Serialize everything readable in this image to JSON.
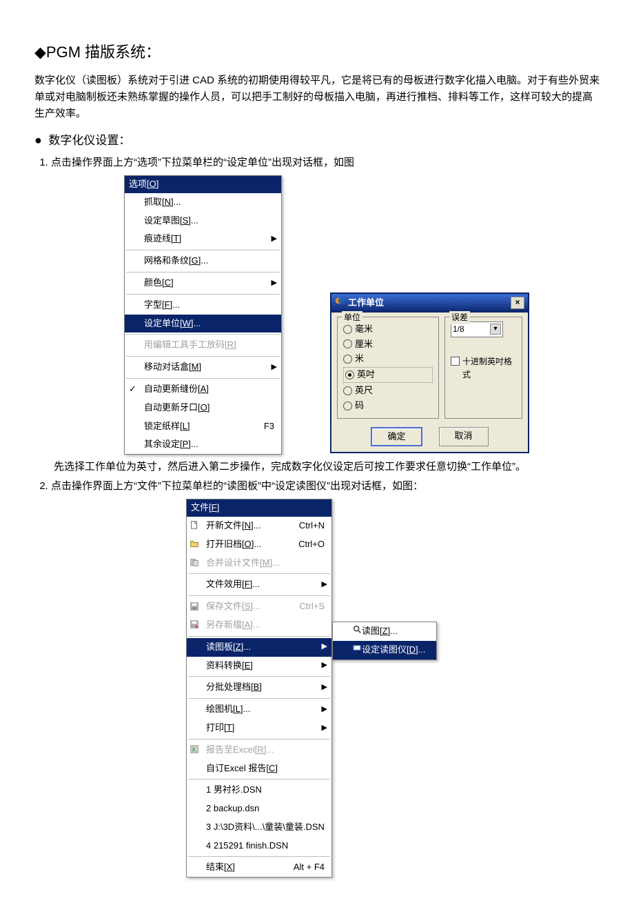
{
  "heading": "PGM 描版系统：",
  "intro": "数字化仪（读图板）系统对于引进 CAD 系统的初期使用得较平凡，它是将已有的母板进行数字化描入电脑。对于有些外贸来单或对电脑制板还未熟练掌握的操作人员，可以把手工制好的母板描入电脑，再进行推档、排料等工作，这样可较大的提高生产效率。",
  "h2": "数字化仪设置：",
  "step1": "点击操作界面上方“选项”下拉菜单栏的“设定单位”出现对话框，如图",
  "step1_note": "先选择工作单位为英寸，然后进入第二步操作，完成数字化仪设定后可按工作要求任意切换“工作单位”。",
  "step2": "点击操作界面上方“文件”下拉菜单栏的“读图板”中“设定读图仪”出现对话框，如图：",
  "menu1": {
    "title": "选项[O]",
    "items": [
      {
        "label": "抓取[N]..."
      },
      {
        "label": "设定草图[S]..."
      },
      {
        "label": "痕迹线[T]",
        "arrow": true
      },
      {
        "sep": true
      },
      {
        "label": "网格和条纹[G]..."
      },
      {
        "sep": true
      },
      {
        "label": "颜色[C]",
        "arrow": true
      },
      {
        "sep": true
      },
      {
        "label": "字型[F]..."
      },
      {
        "label": "设定单位[W]...",
        "sel": true
      },
      {
        "sep": true
      },
      {
        "label": "用编辑工具手工放码[R]",
        "disabled": true
      },
      {
        "sep": true
      },
      {
        "label": "移动对话盒[M]",
        "arrow": true
      },
      {
        "sep": true
      },
      {
        "label": "自动更新缝份[A]",
        "check": true
      },
      {
        "label": "自动更新牙口[O]"
      },
      {
        "label": "锁定纸样[L]",
        "shortcut": "F3"
      },
      {
        "label": "其余设定[P]..."
      }
    ]
  },
  "dialog": {
    "title": "工作单位",
    "group_unit": "单位",
    "group_err": "误差",
    "units": [
      "毫米",
      "厘米",
      "米",
      "英吋",
      "英尺",
      "码"
    ],
    "unit_selected": "英吋",
    "err_value": "1/8",
    "chk": "十进制英吋格式",
    "ok": "确定",
    "cancel": "取消"
  },
  "menu2": {
    "title": "文件[F]",
    "items": [
      {
        "label": "开新文件[N]...",
        "shortcut": "Ctrl+N",
        "icon": "new"
      },
      {
        "label": "打开旧档[O]...",
        "shortcut": "Ctrl+O",
        "icon": "open"
      },
      {
        "label": "合并设计文件[M]...",
        "disabled": true,
        "icon": "merge"
      },
      {
        "sep": true
      },
      {
        "label": "文件效用[F]...",
        "arrow": true
      },
      {
        "sep": true
      },
      {
        "label": "保存文件[S]...",
        "shortcut": "Ctrl+S",
        "disabled": true,
        "icon": "save"
      },
      {
        "label": "另存新檔[A]...",
        "disabled": true,
        "icon": "saveas"
      },
      {
        "sep": true
      },
      {
        "label": "读图板[Z]...",
        "arrow": true,
        "sel": true
      },
      {
        "label": "资料转换[E]",
        "arrow": true
      },
      {
        "sep": true
      },
      {
        "label": "分批处理档[B]",
        "arrow": true
      },
      {
        "sep": true
      },
      {
        "label": "绘图机[L]...",
        "arrow": true
      },
      {
        "label": "打印[T]",
        "arrow": true
      },
      {
        "sep": true
      },
      {
        "label": "报告至Excel[R]...",
        "disabled": true,
        "icon": "excel"
      },
      {
        "label": "自订Excel 报告[C]"
      },
      {
        "sep": true
      },
      {
        "label": "1 男衬衫.DSN"
      },
      {
        "label": "2 backup.dsn"
      },
      {
        "label": "3 J:\\3D资料\\...\\童装\\童装.DSN"
      },
      {
        "label": "4 215291 finish.DSN"
      },
      {
        "sep": true
      },
      {
        "label": "结束[X]",
        "shortcut": "Alt + F4"
      }
    ],
    "submenu": [
      {
        "label": "读图[Z]...",
        "icon": "read"
      },
      {
        "label": "设定读图仪[D]...",
        "sel": true,
        "icon": "setread"
      }
    ]
  }
}
